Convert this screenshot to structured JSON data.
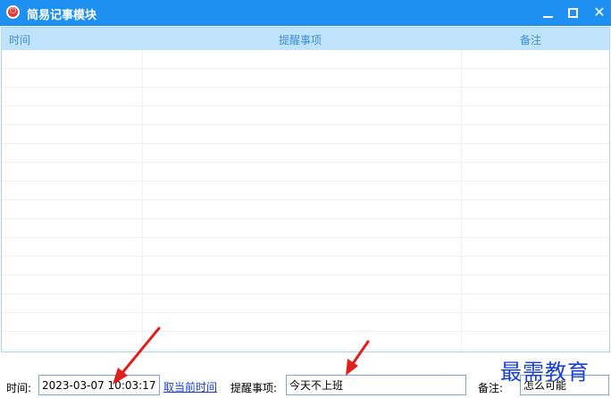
{
  "window": {
    "title": "简易记事模块",
    "icon": "power-icon",
    "controls": [
      "minimize-icon",
      "maximize-icon",
      "close-icon"
    ],
    "close_glyph": "✕"
  },
  "grid": {
    "columns": [
      "时间",
      "提醒事项",
      "备注"
    ],
    "rows": []
  },
  "form": {
    "time_label": "时间:",
    "time_value": "2023-03-07 10:03:17",
    "get_time_link": "取当前时间",
    "item_label": "提醒事项:",
    "item_value": "今天不上班",
    "note_label": "备注:",
    "note_value": "怎么可能"
  },
  "watermark": "最需教育",
  "colors": {
    "titlebar": "#1e90f2",
    "header_bg": "#bfe3fb",
    "header_text": "#3d8fe0",
    "link": "#1a3fd6",
    "arrow": "#e0201c"
  }
}
